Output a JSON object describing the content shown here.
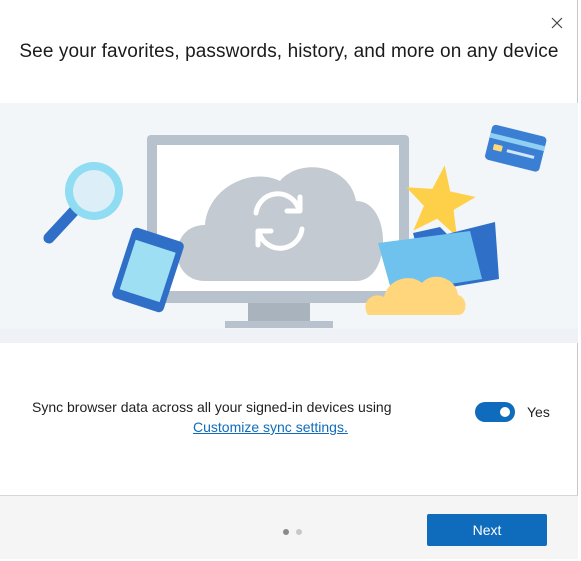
{
  "dialog": {
    "title": "See your favorites, passwords, history, and more on any device",
    "close_icon": "close-icon"
  },
  "illustration": {
    "icons": [
      "magnifier-icon",
      "phone-icon",
      "monitor-icon",
      "cloud-sync-icon",
      "credit-card-icon",
      "star-icon",
      "folder-icon",
      "cloud-icon"
    ]
  },
  "sync": {
    "description": "Sync browser data across all your signed-in devices using",
    "link_label": "Customize sync settings.",
    "toggle_on": true,
    "toggle_label": "Yes"
  },
  "footer": {
    "pager": {
      "current": 1,
      "total": 2
    },
    "next_label": "Next"
  },
  "colors": {
    "accent": "#0f6cbd",
    "illustration_background": "#f3f6f9",
    "footer_background": "#f5f5f5"
  }
}
